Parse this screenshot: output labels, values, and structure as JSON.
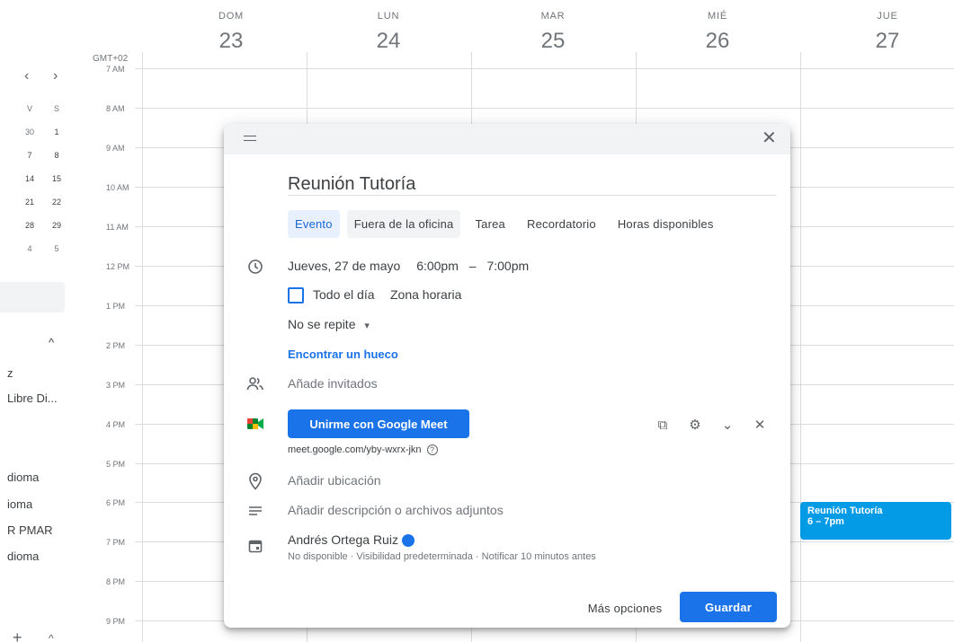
{
  "header": {
    "timezone": "GMT+02",
    "days": [
      {
        "name": "DOM",
        "number": "23"
      },
      {
        "name": "LUN",
        "number": "24"
      },
      {
        "name": "MAR",
        "number": "25"
      },
      {
        "name": "MIÉ",
        "number": "26"
      },
      {
        "name": "JUE",
        "number": "27"
      }
    ]
  },
  "time_labels": [
    "7 AM",
    "8 AM",
    "9 AM",
    "10 AM",
    "11 AM",
    "12 PM",
    "1 PM",
    "2 PM",
    "3 PM",
    "4 PM",
    "5 PM",
    "6 PM",
    "7 PM",
    "8 PM",
    "9 PM"
  ],
  "sidebar": {
    "prev_icon": "‹",
    "next_icon": "›",
    "mini_calendar": {
      "headers": [
        "V",
        "S"
      ],
      "rows": [
        [
          "30",
          "1"
        ],
        [
          "7",
          "8"
        ],
        [
          "14",
          "15"
        ],
        [
          "21",
          "22"
        ],
        [
          "28",
          "29"
        ],
        [
          "4",
          "5"
        ]
      ]
    },
    "collapse_icon": "^",
    "items": [
      "z",
      "Libre Di...",
      "dioma",
      "ioma",
      "R PMAR",
      "dioma"
    ],
    "add_icon": "+",
    "bottom_caret": "^"
  },
  "calendar_event": {
    "title": "Reunión Tutoría",
    "time": "6 – 7pm",
    "color": "#039be5"
  },
  "dialog": {
    "close_icon": "✕",
    "title": "Reunión Tutoría",
    "tabs": [
      "Evento",
      "Fuera de la oficina",
      "Tarea",
      "Recordatorio",
      "Horas disponibles"
    ],
    "date": "Jueves, 27 de mayo",
    "start_time": "6:00pm",
    "time_separator": "–",
    "end_time": "7:00pm",
    "all_day_label": "Todo el día",
    "timezone_link": "Zona horaria",
    "repeat_label": "No se repite",
    "repeat_caret": "▾",
    "find_slot": "Encontrar un hueco",
    "guests_placeholder": "Añade invitados",
    "meet_button": "Unirme con Google Meet",
    "meet_link": "meet.google.com/yby-wxrx-jkn",
    "help_glyph": "?",
    "meet_tools": {
      "copy": "⧉",
      "settings": "⚙",
      "expand": "⌄",
      "remove": "✕"
    },
    "location_placeholder": "Añadir ubicación",
    "description_placeholder": "Añadir descripción o archivos adjuntos",
    "owner_name": "Andrés Ortega Ruiz",
    "owner_meta": "No disponible · Visibilidad predeterminada · Notificar 10 minutos antes",
    "more_options": "Más opciones",
    "save": "Guardar"
  },
  "colors": {
    "accent": "#1a73e8",
    "event": "#039be5",
    "meet_tab_bg": "#e8f0fe"
  }
}
